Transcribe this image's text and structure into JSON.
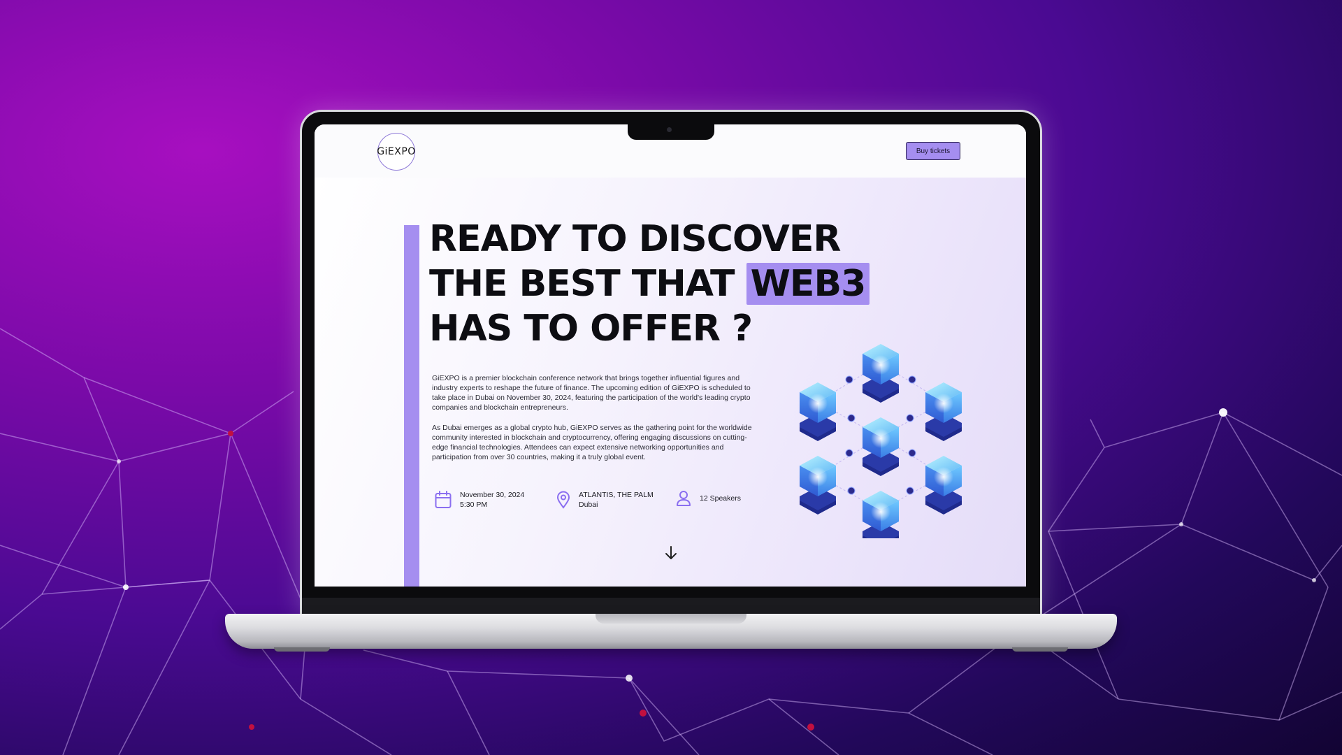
{
  "site": {
    "logo_text": "GiEXPO",
    "buy_label": "Buy tickets"
  },
  "hero": {
    "headline_line1": "READY TO DISCOVER",
    "headline_line2": "THE BEST THAT",
    "headline_highlight": "WEB3",
    "headline_line3": "HAS TO OFFER ?",
    "paragraph1": "GiEXPO is a premier blockchain conference network that brings together influential figures and industry experts to reshape the future of finance. The upcoming edition of GiEXPO is scheduled to take place in Dubai on November 30, 2024, featuring the participation of the world's leading crypto companies and blockchain entrepreneurs.",
    "paragraph2": "As Dubai emerges as a global crypto hub, GiEXPO serves as the gathering point for the worldwide community interested in blockchain and cryptocurrency, offering engaging discussions on cutting-edge financial technologies. Attendees can expect extensive networking opportunities and participation from over 30 countries, making it a truly global event."
  },
  "info": {
    "date": "November 30, 2024",
    "time": "5:30 PM",
    "venue": "ATLANTIS, THE PALM",
    "city": "Dubai",
    "speakers": "12 Speakers"
  },
  "icons": {
    "date": "calendar-icon",
    "location": "map-pin-icon",
    "speakers": "person-icon",
    "scroll": "arrow-down-icon",
    "illustration": "blockchain-cubes-icon"
  },
  "colors": {
    "accent": "#a58ef0",
    "background": "#7a0aa8",
    "text": "#0d0d12"
  }
}
